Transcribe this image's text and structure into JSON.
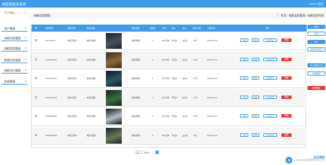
{
  "header": {
    "title": "电影院售票系统",
    "user": "admin 退出"
  },
  "sidebar": {
    "items": [
      {
        "label": "个人中心"
      },
      {
        "label": "用户管理"
      },
      {
        "label": "电影信息管理"
      },
      {
        "label": "电影类型管理"
      },
      {
        "label": "售票信息管理"
      },
      {
        "label": "电影评价管理"
      },
      {
        "label": "系统管理"
      }
    ]
  },
  "breadcrumb": {
    "left": "电影信息管理",
    "right": "首页 / 电影信息管理 / 电影信息列表"
  },
  "right_actions": [
    {
      "label": "新增",
      "style": "blue"
    },
    {
      "label": "导出",
      "style": "white"
    },
    {
      "label": "导入",
      "style": "blue"
    },
    {
      "label": "电影评价统计",
      "style": "white"
    },
    {
      "label": "导入模板下载",
      "style": "blue"
    },
    {
      "label": "批量删除",
      "style": "white"
    },
    {
      "label": "批量删除",
      "style": "red"
    }
  ],
  "table": {
    "headers": [
      "电影编号",
      "电影名称",
      "电影封面",
      "",
      "电影类型",
      "放映厅",
      "时长",
      "导演",
      "主演",
      "电影价格",
      "上映时间",
      "操作"
    ],
    "rows": [
      {
        "code": "1111111111",
        "name": "电影名称1",
        "cover_text": "电影封面1",
        "type": "喜剧/剧情",
        "hall": "1",
        "duration": "120分钟",
        "director": "导演1",
        "actor": "主演1",
        "price": "45元",
        "date": "2022-03-10"
      },
      {
        "code": "2222222222",
        "name": "电影名称2",
        "cover_text": "电影封面2",
        "type": "喜剧/剧情",
        "hall": "2",
        "duration": "120分钟",
        "director": "导演2",
        "actor": "主演2",
        "price": "45元",
        "date": "2022-03-10"
      },
      {
        "code": "3333333333",
        "name": "电影名称3",
        "cover_text": "电影封面3",
        "type": "喜剧/剧情",
        "hall": "3",
        "duration": "120分钟",
        "director": "导演3",
        "actor": "主演3",
        "price": "45元",
        "date": "2022-03-10"
      },
      {
        "code": "4444444444",
        "name": "电影名称4",
        "cover_text": "电影封面4",
        "type": "喜剧/剧情",
        "hall": "4",
        "duration": "120分钟",
        "director": "导演4",
        "actor": "主演4",
        "price": "45元",
        "date": "2022-03-10"
      },
      {
        "code": "5555555555",
        "name": "电影名称5",
        "cover_text": "电影封面5",
        "type": "喜剧/剧情",
        "hall": "5",
        "duration": "120分钟",
        "director": "导演5",
        "actor": "主演5",
        "price": "45元",
        "date": "2022-03-10"
      },
      {
        "code": "6666666666",
        "name": "电影名称6",
        "cover_text": "电影封面6",
        "type": "喜剧/剧情",
        "hall": "6",
        "duration": "120分钟",
        "director": "导演6",
        "actor": "主演6",
        "price": "45元",
        "date": "2022-03-10"
      }
    ],
    "row_actions": {
      "view": "详情",
      "edit": "修改",
      "review": "查看评论",
      "delete": "删除"
    }
  },
  "pager": {
    "page_size": "10",
    "total": "共6条",
    "prev": "<",
    "current": "1"
  },
  "watermark": {
    "text": "CSDN @毕设程序员小伍",
    "brand": "毕设源码"
  },
  "colors": {
    "primary": "#3d9be9",
    "danger": "#e6393d",
    "row_alt": "#f5f5f5"
  }
}
